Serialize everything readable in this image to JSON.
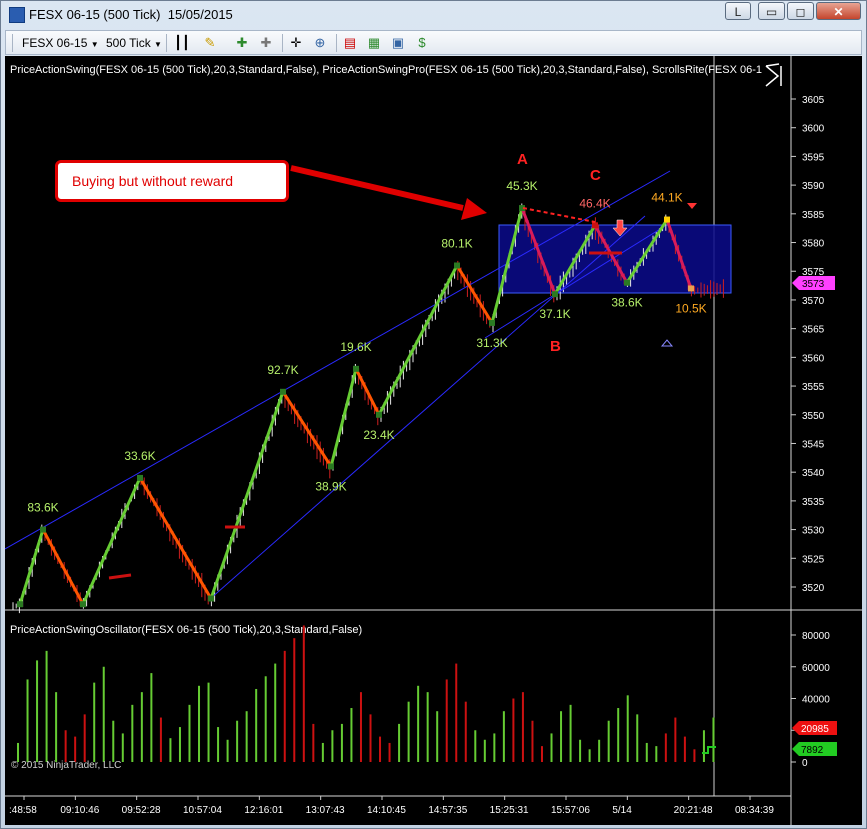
{
  "window": {
    "title": "FESX 06-15 (500 Tick)  15/05/2015",
    "buttons": {
      "link": "L",
      "minimize": "▭",
      "maximize": "◻",
      "close": "✕"
    }
  },
  "toolbar": {
    "instrument": "FESX 06-15",
    "interval": "500 Tick",
    "icons": [
      "bar-type-icon",
      "drawing-pencil-icon",
      "add-indicator-icon",
      "strategy-icon",
      "crosshair-icon",
      "zoom-icon",
      "chart-style-icon",
      "data-box-icon",
      "chart-trader-icon",
      "order-icon"
    ]
  },
  "indicators": {
    "main_label": "PriceActionSwing(FESX 06-15 (500 Tick),20,3,Standard,False), PriceActionSwingPro(FESX 06-15 (500 Tick),20,3,Standard,False), ScrollsRite(FESX 06-15",
    "osc_label": "PriceActionSwingOscillator(FESX 06-15 (500 Tick),20,3,Standard,False)"
  },
  "annotation": {
    "callout_text": "Buying but without reward",
    "point_A": "A",
    "point_B": "B",
    "point_C": "C"
  },
  "current_price": "3573",
  "osc_values": {
    "red": "20985",
    "green": "7892"
  },
  "copyright": "© 2015 NinjaTrader, LLC",
  "colors": {
    "up": "#66cc33",
    "down": "#ff5500",
    "red": "#cc1111",
    "channel": "#1a1aff",
    "box_fill": "#0a0a8c",
    "label_green": "#b6f06b",
    "label_red": "#ff6666",
    "label_orange": "#ffaa22",
    "marker_magenta": "#ff40ff"
  },
  "chart_data": [
    {
      "type": "line",
      "title": "",
      "y_ticks": [
        3520,
        3525,
        3530,
        3535,
        3540,
        3545,
        3550,
        3555,
        3560,
        3565,
        3570,
        3575,
        3580,
        3585,
        3590,
        3595,
        3600,
        3605
      ],
      "ylim": [
        3515,
        3610
      ],
      "x_tick_labels": [
        ":48:58",
        "09:10:46",
        "09:52:28",
        "10:57:04",
        "12:16:01",
        "13:07:43",
        "14:10:45",
        "14:57:35",
        "15:25:31",
        "15:57:06",
        "5/14",
        "20:21:48",
        "08:34:39"
      ],
      "swing_points": [
        {
          "i": 0,
          "y": 3517,
          "label": ""
        },
        {
          "i": 1,
          "y": 3530,
          "label": "83.6K"
        },
        {
          "i": 2,
          "y": 3517,
          "label": ""
        },
        {
          "i": 3,
          "y": 3539,
          "label": "33.6K"
        },
        {
          "i": 4,
          "y": 3518,
          "label": ""
        },
        {
          "i": 5,
          "y": 3554,
          "label": "92.7K"
        },
        {
          "i": 6,
          "y": 3541,
          "label": "38.9K"
        },
        {
          "i": 7,
          "y": 3558,
          "label": "19.6K"
        },
        {
          "i": 8,
          "y": 3550,
          "label": "23.4K"
        },
        {
          "i": 9,
          "y": 3576,
          "label": "80.1K"
        },
        {
          "i": 10,
          "y": 3566,
          "label": "31.3K"
        },
        {
          "i": 11,
          "y": 3586,
          "label": "45.3K"
        },
        {
          "i": 12,
          "y": 3571,
          "label": "37.1K"
        },
        {
          "i": 13,
          "y": 3583,
          "label": "46.4K"
        },
        {
          "i": 14,
          "y": 3573,
          "label": "38.6K"
        },
        {
          "i": 15,
          "y": 3584,
          "label": "44.1K"
        },
        {
          "i": 16,
          "y": 3572,
          "label": "10.5K"
        }
      ]
    },
    {
      "type": "bar",
      "title": "",
      "y_ticks": [
        0,
        20000,
        40000,
        60000,
        80000
      ],
      "ylim": [
        0,
        88000
      ],
      "series": [
        {
          "name": "",
          "values": [
            12000,
            52000,
            64000,
            70000,
            44000,
            20000,
            16000,
            30000,
            50000,
            60000,
            26000,
            18000,
            36000,
            44000,
            56000,
            28000,
            15000,
            22000,
            36000,
            48000,
            50000,
            22000,
            14000,
            26000,
            32000,
            46000,
            54000,
            62000,
            70000,
            78000,
            86000,
            24000,
            12000,
            20000,
            24000,
            34000,
            44000,
            30000,
            16000,
            12000,
            24000,
            38000,
            48000,
            44000,
            32000,
            52000,
            62000,
            38000,
            20000,
            14000,
            18000,
            32000,
            40000,
            44000,
            26000,
            10000,
            18000,
            32000,
            36000,
            14000,
            8000,
            14000,
            26000,
            34000,
            42000,
            30000,
            12000,
            10000,
            18000,
            28000,
            16000,
            8000,
            20000,
            28000
          ]
        }
      ]
    }
  ]
}
